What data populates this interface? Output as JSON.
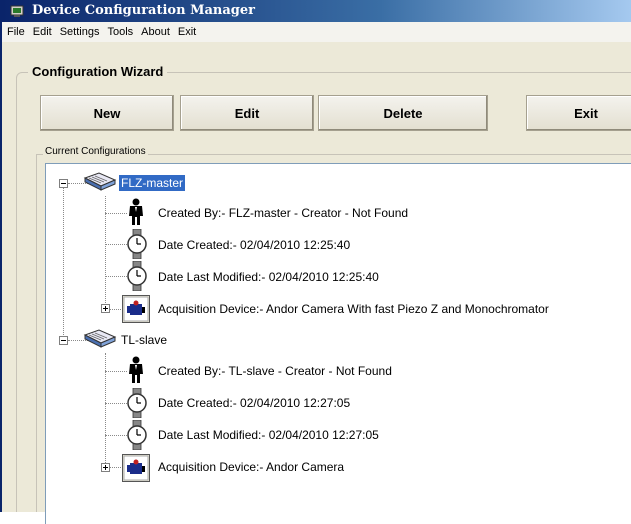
{
  "window": {
    "title": "Device Configuration Manager"
  },
  "menu": [
    {
      "label": "File"
    },
    {
      "label": "Edit"
    },
    {
      "label": "Settings"
    },
    {
      "label": "Tools"
    },
    {
      "label": "About"
    },
    {
      "label": "Exit"
    }
  ],
  "wizard": {
    "label": "Configuration Wizard",
    "buttons": {
      "new": "New",
      "edit": "Edit",
      "delete": "Delete",
      "exit": "Exit"
    }
  },
  "configurations": {
    "label": "Current Configurations",
    "items": [
      {
        "name": "FLZ-master",
        "selected": true,
        "created_by": "Created By:- FLZ-master - Creator - Not Found",
        "date_created": "Date Created:- 02/04/2010 12:25:40",
        "date_modified": "Date Last Modified:- 02/04/2010 12:25:40",
        "acquisition_device": "Acquisition Device:- Andor Camera With fast Piezo Z and Monochromator"
      },
      {
        "name": "TL-slave",
        "selected": false,
        "created_by": "Created By:- TL-slave - Creator - Not Found",
        "date_created": "Date Created:- 02/04/2010 12:27:05",
        "date_modified": "Date Last Modified:- 02/04/2010 12:27:05",
        "acquisition_device": "Acquisition Device:- Andor Camera"
      }
    ]
  }
}
